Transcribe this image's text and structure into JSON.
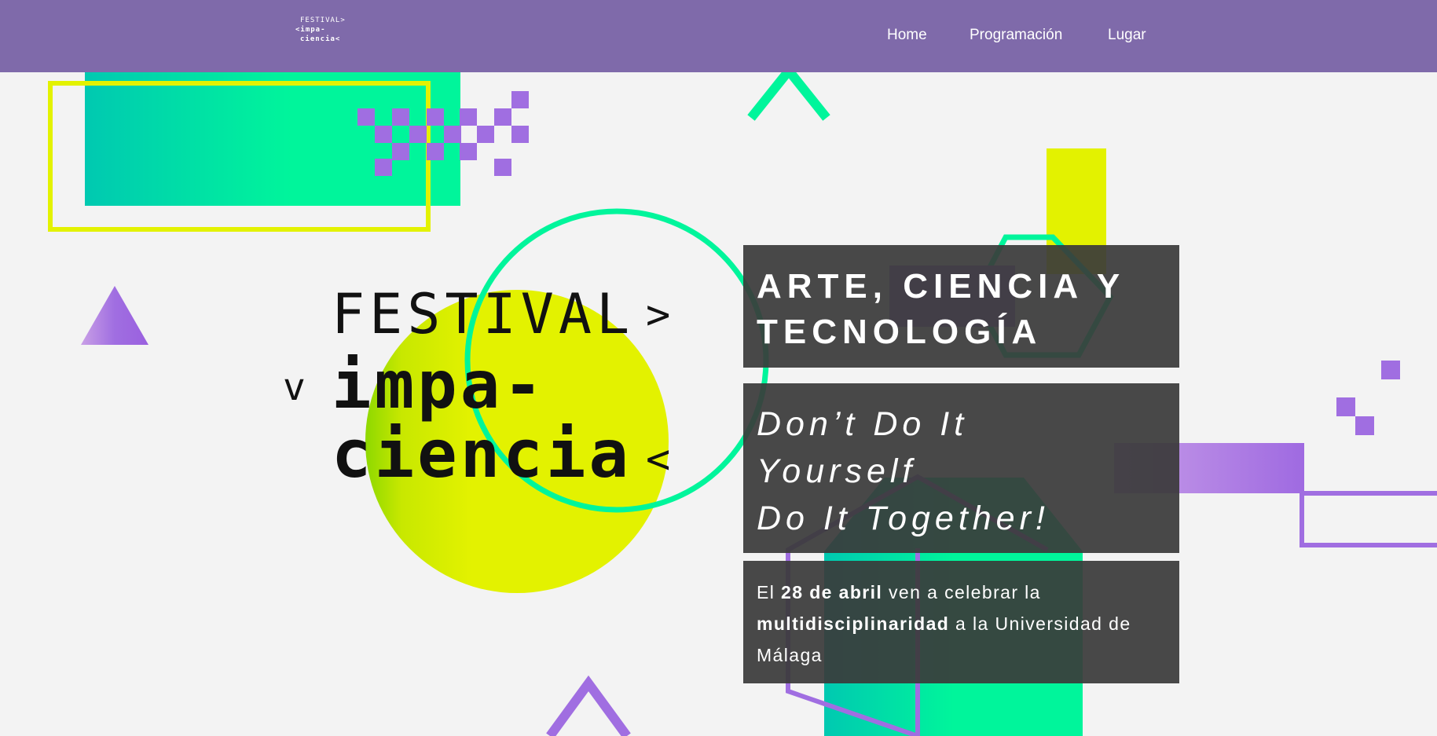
{
  "nav": {
    "logo": {
      "line1": "FESTIVAL>",
      "line2": "<impa-",
      "line3": "ciencia<"
    },
    "items": [
      {
        "label": "Home"
      },
      {
        "label": "Programación"
      },
      {
        "label": "Lugar"
      }
    ]
  },
  "hero": {
    "logo": {
      "line1": "FESTIVAL",
      "line2": "impa-",
      "line3": "ciencia",
      "chevron_left": "v",
      "chevron_right_1": ">",
      "chevron_right_3": "<"
    },
    "headline": "ARTE, CIENCIA Y TECNOLOGÍA",
    "slogan": {
      "line1": "Don’t Do It",
      "line2": "Yourself",
      "line3": "Do It Together!"
    },
    "description": {
      "prefix": "El ",
      "date": "28 de abril",
      "middle": " ven a celebrar la ",
      "highlight": "multidisciplinaridad",
      "suffix": " a la Universidad de Málaga"
    }
  },
  "colors": {
    "nav_bg": "#7f6aaa",
    "page_bg": "#f3f3f3",
    "green": "#00f59b",
    "teal": "#00c9b1",
    "yellow": "#e3f200",
    "purple": "#a06ee1",
    "box_bg": "#3a3a3a"
  },
  "icons": [
    "logo-mark",
    "triangle-shape",
    "circle-shape",
    "hexagon-shape",
    "pixel-checker-shape"
  ]
}
